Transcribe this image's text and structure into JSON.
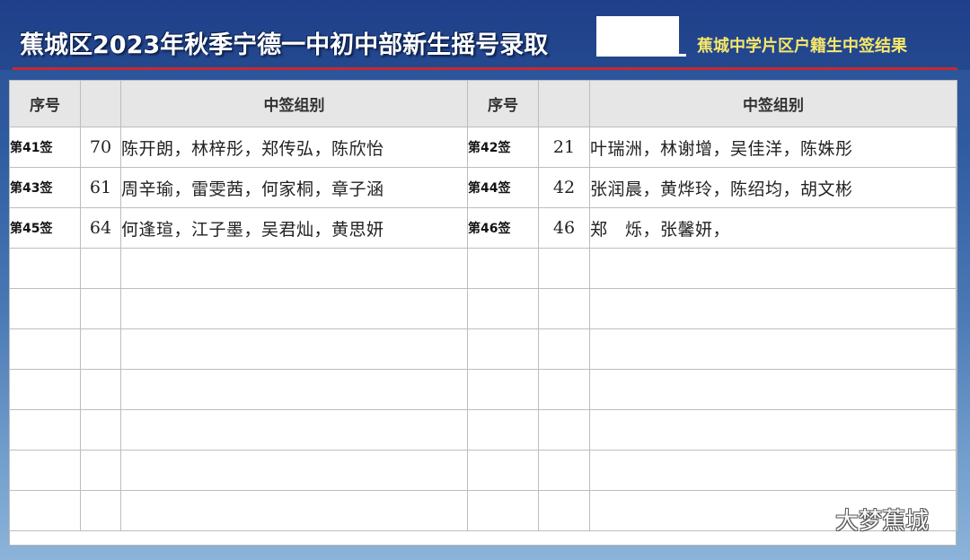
{
  "header": {
    "title": "蕉城区2023年秋季宁德一中初中部新生摇号录取",
    "subtitle": "蕉城中学片区户籍生中签结果"
  },
  "table": {
    "headers": [
      "序号",
      "",
      "中签组别",
      "序号",
      "",
      "中签组别"
    ],
    "rows": [
      {
        "left": {
          "seq": "第41签",
          "num": "70",
          "names": "陈开朗，林梓彤，郑传弘，陈欣怡"
        },
        "right": {
          "seq": "第42签",
          "num": "21",
          "names": "叶瑞洲，林谢增，吴佳洋，陈姝彤"
        }
      },
      {
        "left": {
          "seq": "第43签",
          "num": "61",
          "names": "周辛瑜，雷雯茜，何家桐，章子涵"
        },
        "right": {
          "seq": "第44签",
          "num": "42",
          "names": "张润晨，黄烨玲，陈绍均，胡文彬"
        }
      },
      {
        "left": {
          "seq": "第45签",
          "num": "64",
          "names": "何逢瑄，江子墨，吴君灿，黄思妍"
        },
        "right": {
          "seq": "第46签",
          "num": "46",
          "names": "郑　烁，张馨妍，"
        }
      }
    ],
    "empty_row_count": 7
  },
  "watermark": {
    "icon": "wechat-icon",
    "text": "大梦蕉城"
  },
  "colors": {
    "header_bg": "#1f3f8a",
    "title_text": "#ffffff",
    "subtitle_text": "#f6e76a",
    "divider_red": "#c7282e",
    "table_header_bg": "#e6e6e6"
  }
}
